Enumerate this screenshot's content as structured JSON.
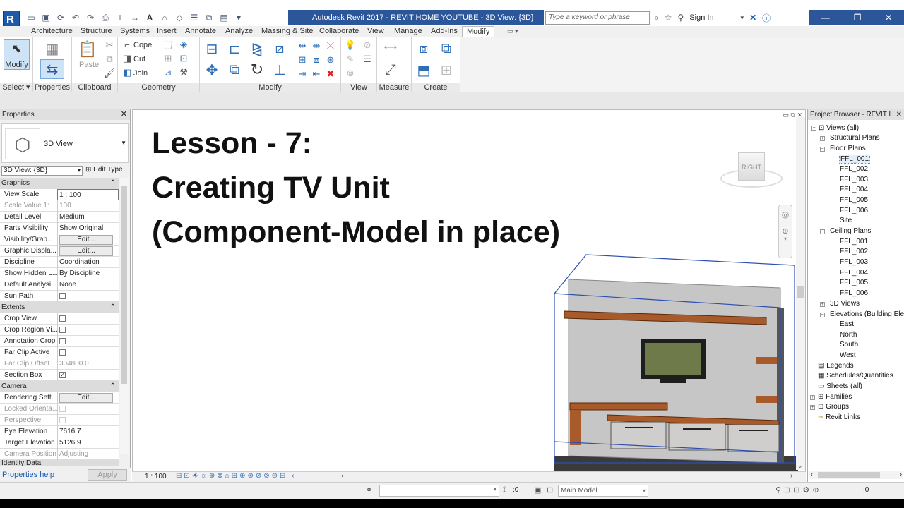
{
  "window": {
    "title": "Autodesk Revit 2017 -    REVIT  HOME YOUTUBE - 3D View: {3D}",
    "search_placeholder": "Type a keyword or phrase",
    "sign_in": "Sign In",
    "accent": "#2b579a"
  },
  "tabs": [
    "Architecture",
    "Structure",
    "Systems",
    "Insert",
    "Annotate",
    "Analyze",
    "Massing & Site",
    "Collaborate",
    "View",
    "Manage",
    "Add-Ins",
    "Modify"
  ],
  "ribbon": {
    "modify_label": "Modify",
    "paste_label": "Paste",
    "cope_label": "Cope",
    "cut_label": "Cut",
    "join_label": "Join",
    "panels": [
      "Select",
      "Properties",
      "Clipboard",
      "Geometry",
      "Modify",
      "View",
      "Measure",
      "Create"
    ]
  },
  "properties": {
    "header": "Properties",
    "type_name": "3D View",
    "selector": "3D View: {3D}",
    "edit_type": "Edit Type",
    "help": "Properties help",
    "apply": "Apply",
    "sections": {
      "graphics": "Graphics",
      "extents": "Extents",
      "camera": "Camera",
      "identity": "Identity Data"
    },
    "graphics_rows": [
      {
        "label": "View Scale",
        "value": "1 : 100"
      },
      {
        "label": "Scale Value    1:",
        "value": "100"
      },
      {
        "label": "Detail Level",
        "value": "Medium"
      },
      {
        "label": "Parts Visibility",
        "value": "Show Original"
      },
      {
        "label": "Visibility/Grap...",
        "value": "Edit..."
      },
      {
        "label": "Graphic Displa...",
        "value": "Edit..."
      },
      {
        "label": "Discipline",
        "value": "Coordination"
      },
      {
        "label": "Show Hidden L...",
        "value": "By Discipline"
      },
      {
        "label": "Default Analysi...",
        "value": "None"
      },
      {
        "label": "Sun Path",
        "value": ""
      }
    ],
    "extents_rows": [
      {
        "label": "Crop View",
        "value": ""
      },
      {
        "label": "Crop Region Vi...",
        "value": ""
      },
      {
        "label": "Annotation Crop",
        "value": ""
      },
      {
        "label": "Far Clip Active",
        "value": ""
      },
      {
        "label": "Far Clip Offset",
        "value": "304800.0"
      },
      {
        "label": "Section Box",
        "value": ""
      }
    ],
    "camera_rows": [
      {
        "label": "Rendering Sett...",
        "value": "Edit..."
      },
      {
        "label": "Locked Orienta...",
        "value": ""
      },
      {
        "label": "Perspective",
        "value": ""
      },
      {
        "label": "Eye Elevation",
        "value": "7616.7"
      },
      {
        "label": "Target Elevation",
        "value": "5126.9"
      },
      {
        "label": "Camera Position",
        "value": "Adjusting"
      }
    ]
  },
  "viewport": {
    "lesson_line1": "Lesson - 7:",
    "lesson_line2": "Creating TV Unit",
    "lesson_line3": "(Component-Model in place)",
    "viewcube_label": "RIGHT",
    "scale": "1 : 100"
  },
  "project_browser": {
    "header": "Project Browser - REVIT  H...",
    "items": {
      "views_all": "Views (all)",
      "structural_plans": "Structural Plans",
      "floor_plans": "Floor Plans",
      "ffl_001": "FFL_001",
      "ffl_002": "FFL_002",
      "ffl_003": "FFL_003",
      "ffl_004": "FFL_004",
      "ffl_005": "FFL_005",
      "ffl_006": "FFL_006",
      "site": "Site",
      "ceiling_plans": "Ceiling Plans",
      "c_ffl_001": "FFL_001",
      "c_ffl_002": "FFL_002",
      "c_ffl_003": "FFL_003",
      "c_ffl_004": "FFL_004",
      "c_ffl_005": "FFL_005",
      "c_ffl_006": "FFL_006",
      "views_3d": "3D Views",
      "elevations": "Elevations (Building Ele",
      "east": "East",
      "north": "North",
      "south": "South",
      "west": "West",
      "legends": "Legends",
      "schedules": "Schedules/Quantities",
      "sheets": "Sheets (all)",
      "families": "Families",
      "groups": "Groups",
      "revit_links": "Revit Links"
    }
  },
  "statusbar": {
    "count_left": ":0",
    "main_model": "Main Model",
    "count_right": ":0"
  }
}
